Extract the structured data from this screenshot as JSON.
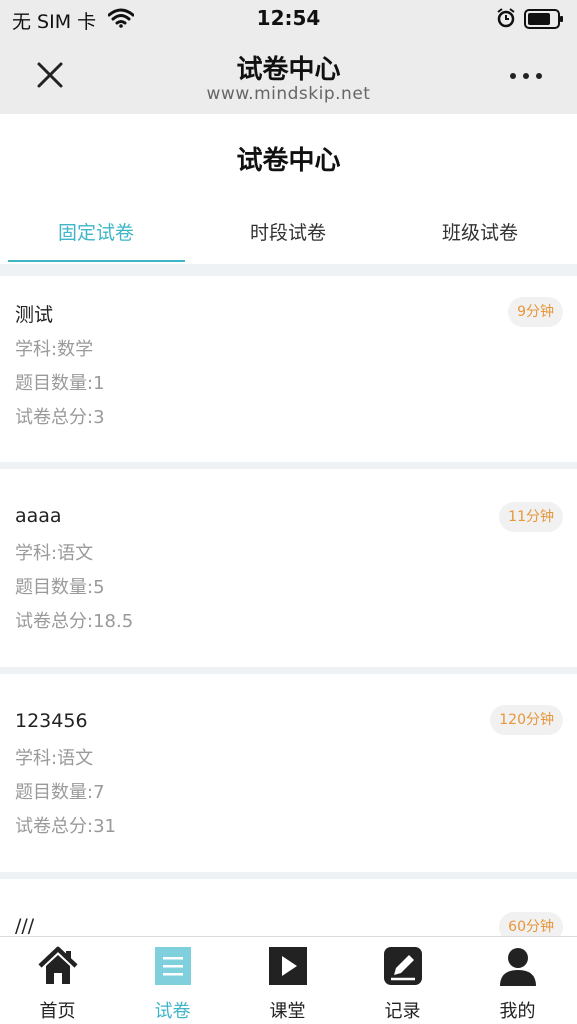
{
  "status_bar": {
    "carrier": "无 SIM 卡",
    "time": "12:54"
  },
  "nav": {
    "title": "试卷中心",
    "url": "www.mindskip.net"
  },
  "page_title": "试卷中心",
  "tabs": [
    {
      "label": "固定试卷",
      "active": true
    },
    {
      "label": "时段试卷",
      "active": false
    },
    {
      "label": "班级试卷",
      "active": false
    }
  ],
  "papers": [
    {
      "name": "测试",
      "subject": "学科:数学",
      "count": "题目数量:1",
      "score": "试卷总分:3",
      "duration": "9分钟"
    },
    {
      "name": "aaaa",
      "subject": "学科:语文",
      "count": "题目数量:5",
      "score": "试卷总分:18.5",
      "duration": "11分钟"
    },
    {
      "name": "123456",
      "subject": "学科:语文",
      "count": "题目数量:7",
      "score": "试卷总分:31",
      "duration": "120分钟"
    },
    {
      "name": "///",
      "duration": "60分钟"
    }
  ],
  "bottom_tabs": [
    {
      "label": "首页",
      "icon": "home-icon"
    },
    {
      "label": "试卷",
      "icon": "exam-icon",
      "active": true
    },
    {
      "label": "课堂",
      "icon": "play-icon"
    },
    {
      "label": "记录",
      "icon": "edit-record-icon"
    },
    {
      "label": "我的",
      "icon": "person-icon"
    }
  ],
  "colors": {
    "accent": "#3fb6c8",
    "badge_text": "#e8963a",
    "secondary_text": "#9a9a9a",
    "header_bg": "#ececec"
  }
}
